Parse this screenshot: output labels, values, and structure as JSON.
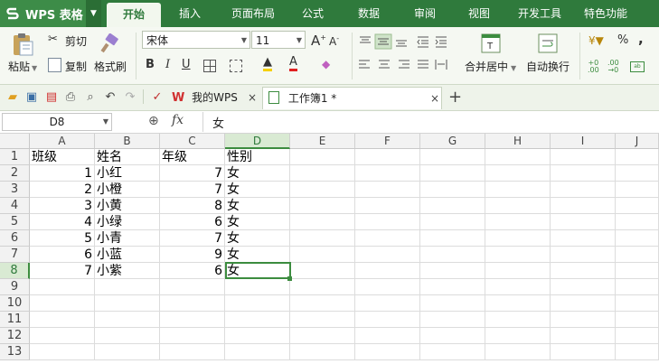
{
  "app": {
    "name": "WPS 表格",
    "menu_tabs": [
      "开始",
      "插入",
      "页面布局",
      "公式",
      "数据",
      "审阅",
      "视图",
      "开发工具",
      "特色功能"
    ],
    "active_tab": "开始"
  },
  "ribbon": {
    "paste": "粘贴",
    "cut": "剪切",
    "copy": "复制",
    "format_painter": "格式刷",
    "font_name": "宋体",
    "font_size": "11",
    "merge_center": "合并居中",
    "wrap_text": "自动换行",
    "percent": "%",
    "comma": ","
  },
  "doc_tabs": {
    "my_wps": "我的WPS",
    "workbook": "工作簿1 *"
  },
  "formula_bar": {
    "name_box": "D8",
    "fx": "fx",
    "value": "女"
  },
  "sheet": {
    "columns": [
      "A",
      "B",
      "C",
      "D",
      "E",
      "F",
      "G",
      "H",
      "I",
      "J"
    ],
    "rows": [
      "1",
      "2",
      "3",
      "4",
      "5",
      "6",
      "7",
      "8",
      "9",
      "10",
      "11",
      "12",
      "13"
    ],
    "selected_cell": "D8",
    "cells": [
      [
        "班级",
        "姓名",
        "年级",
        "性别"
      ],
      [
        "1",
        "小红",
        "7",
        "女"
      ],
      [
        "2",
        "小橙",
        "7",
        "女"
      ],
      [
        "3",
        "小黄",
        "8",
        "女"
      ],
      [
        "4",
        "小绿",
        "6",
        "女"
      ],
      [
        "5",
        "小青",
        "7",
        "女"
      ],
      [
        "6",
        "小蓝",
        "9",
        "女"
      ],
      [
        "7",
        "小紫",
        "6",
        "女"
      ]
    ]
  },
  "colors": {
    "menubar": "#2f7a3c",
    "accent": "#3c8c3f",
    "ribbon_bg": "#f5f8f2"
  }
}
